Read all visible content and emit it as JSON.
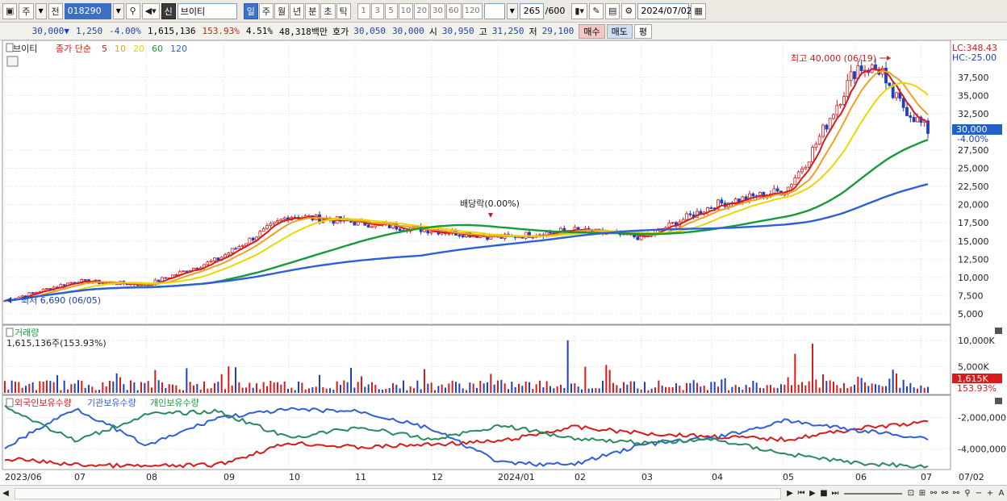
{
  "toolbar": {
    "period_label": "주",
    "prev_label": "전",
    "code": "018290",
    "stock_name": "브이티",
    "stock_badge": "신",
    "periods": [
      "일",
      "주",
      "월",
      "년",
      "분",
      "초",
      "틱"
    ],
    "active_period": "일",
    "intervals": [
      "1",
      "3",
      "5",
      "10",
      "20",
      "30",
      "60",
      "120"
    ],
    "count": "265",
    "count_total": "/600",
    "date": "2024/07/02"
  },
  "quote": {
    "price": "30,000▼",
    "change": "1,250",
    "change_pct": "-4.00%",
    "volume": "1,615,136",
    "volume_ratio": "153.93%",
    "turnover_rate": "4.51%",
    "amount": "48,318백만",
    "bid_label": "호가",
    "bid": "30,050",
    "ask": "30,000",
    "open_label": "시",
    "open": "30,950",
    "high_label": "고",
    "high": "31,250",
    "low_label": "저",
    "low": "29,100",
    "buy_label": "매수",
    "sell_label": "매도",
    "avg_label": "평"
  },
  "price_panel": {
    "name": "브이티",
    "legend_prefix": "종가 단순",
    "legend_items": [
      {
        "label": "5",
        "color": "#d71a1a"
      },
      {
        "label": "10",
        "color": "#f0a020"
      },
      {
        "label": "20",
        "color": "#e8d800"
      },
      {
        "label": "60",
        "color": "#189a3a"
      },
      {
        "label": "120",
        "color": "#2f5fd8"
      }
    ],
    "lc": "LC:348.43",
    "hc": "HC:-25.00",
    "high_annotation": "최고 40,000 (06/19)",
    "low_annotation": "최저 6,690 (06/05)",
    "dividend_annotation": "배당락(0.00%)",
    "current_price_tag": "30,000",
    "current_pct_tag": "-4.00%",
    "y_ticks": [
      "37,500",
      "35,000",
      "32,500",
      "27,500",
      "25,000",
      "22,500",
      "20,000",
      "17,500",
      "15,000",
      "12,500",
      "10,000",
      "7,500",
      "5,000"
    ]
  },
  "volume_panel": {
    "title": "거래량",
    "value": "1,615,136주(153.93%)",
    "y_ticks": [
      "10,000K",
      "5,000K"
    ],
    "current_tag": "1,615K",
    "current_pct": "153.93%"
  },
  "holding_panel": {
    "legend": [
      {
        "label": "외국인보유수량",
        "color": "#d71a1a"
      },
      {
        "label": "기관보유수량",
        "color": "#2f5fd8"
      },
      {
        "label": "개인보유수량",
        "color": "#189a3a"
      }
    ],
    "y_ticks": [
      "-2,000,000",
      "-4,000,000"
    ]
  },
  "x_axis": {
    "labels": [
      "2023/06",
      "07",
      "08",
      "09",
      "10",
      "11",
      "12",
      "2024/01",
      "02",
      "03",
      "04",
      "05",
      "06",
      "07"
    ],
    "right_label": "07/02"
  },
  "chart_data": {
    "type": "candlestick",
    "y_range": [
      5000,
      40000
    ],
    "anchors": [
      {
        "x": "2023/06",
        "close": 6800
      },
      {
        "x": "2023/07",
        "close": 9500
      },
      {
        "x": "2023/08",
        "close": 9000
      },
      {
        "x": "2023/09",
        "close": 12500
      },
      {
        "x": "2023/10",
        "close": 18500
      },
      {
        "x": "2023/11",
        "close": 17500
      },
      {
        "x": "2023/12",
        "close": 16500
      },
      {
        "x": "2024/01",
        "close": 15500
      },
      {
        "x": "2024/02",
        "close": 16500
      },
      {
        "x": "2024/03",
        "close": 15500
      },
      {
        "x": "2024/04",
        "close": 20000
      },
      {
        "x": "2024/05",
        "close": 22000
      },
      {
        "x": "2024/06",
        "close": 36000
      },
      {
        "x": "2024/07",
        "close": 30000
      }
    ]
  }
}
